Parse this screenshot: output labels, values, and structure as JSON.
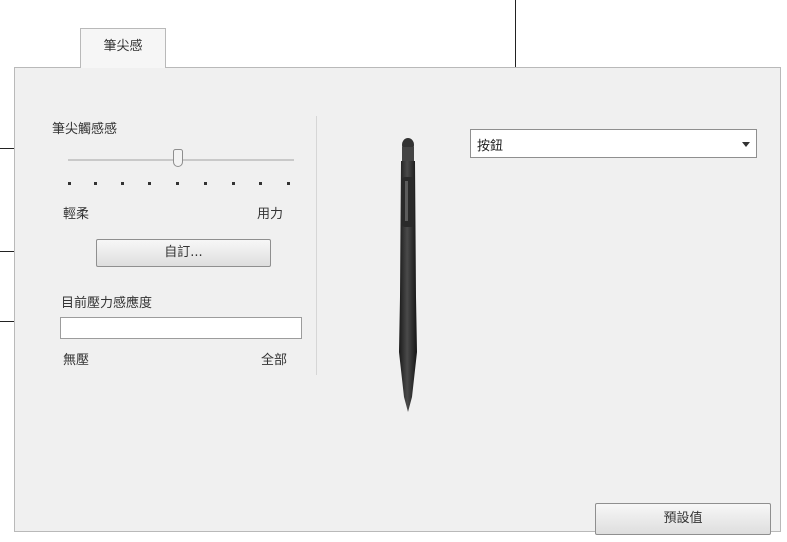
{
  "tab": {
    "label": "筆尖感"
  },
  "settings": {
    "feel_label": "筆尖觸感感",
    "soft_label": "輕柔",
    "firm_label": "用力",
    "customize_button": "自訂...",
    "current_pressure_label": "目前壓力感應度",
    "pressure_min": "無壓",
    "pressure_max": "全部",
    "pressure_level": 0
  },
  "pen_button": {
    "selected": "按鈕"
  },
  "default_button": "預設值"
}
